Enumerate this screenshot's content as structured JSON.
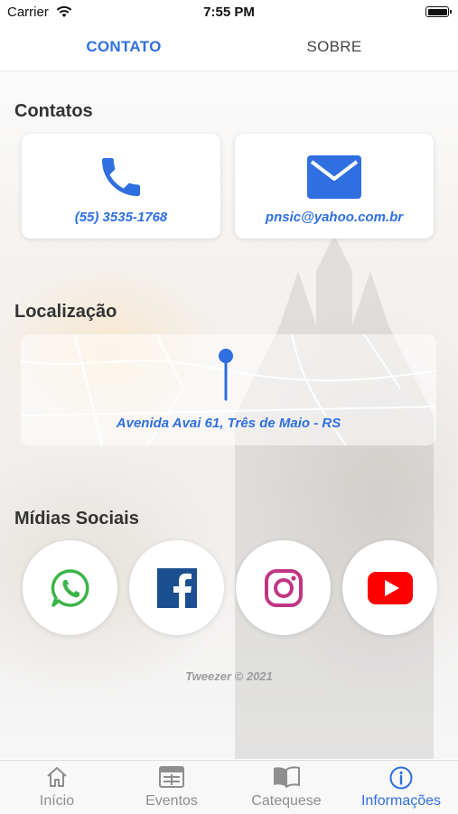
{
  "status_bar": {
    "carrier": "Carrier",
    "time": "7:55 PM"
  },
  "top_tabs": [
    {
      "label": "CONTATO",
      "active": true
    },
    {
      "label": "SOBRE",
      "active": false
    }
  ],
  "contacts": {
    "title": "Contatos",
    "phone": "(55) 3535-1768",
    "email": "pnsic@yahoo.com.br"
  },
  "location": {
    "title": "Localização",
    "address": "Avenida Avai 61, Três de Maio - RS"
  },
  "social": {
    "title": "Mídias Sociais",
    "items": [
      {
        "icon": "whatsapp-icon",
        "color": "#3bb54a"
      },
      {
        "icon": "facebook-icon",
        "color": "#1c4f8f"
      },
      {
        "icon": "instagram-icon",
        "color": "#c13584"
      },
      {
        "icon": "youtube-icon",
        "color": "#ff0000"
      }
    ]
  },
  "footer": "Tweezer © 2021",
  "tabbar": [
    {
      "label": "Início",
      "icon": "home-icon",
      "active": false
    },
    {
      "label": "Eventos",
      "icon": "calendar-icon",
      "active": false
    },
    {
      "label": "Catequese",
      "icon": "book-icon",
      "active": false
    },
    {
      "label": "Informações",
      "icon": "info-icon",
      "active": true
    }
  ],
  "colors": {
    "accent": "#2f6fe0",
    "inactive": "#8e8e8e"
  }
}
